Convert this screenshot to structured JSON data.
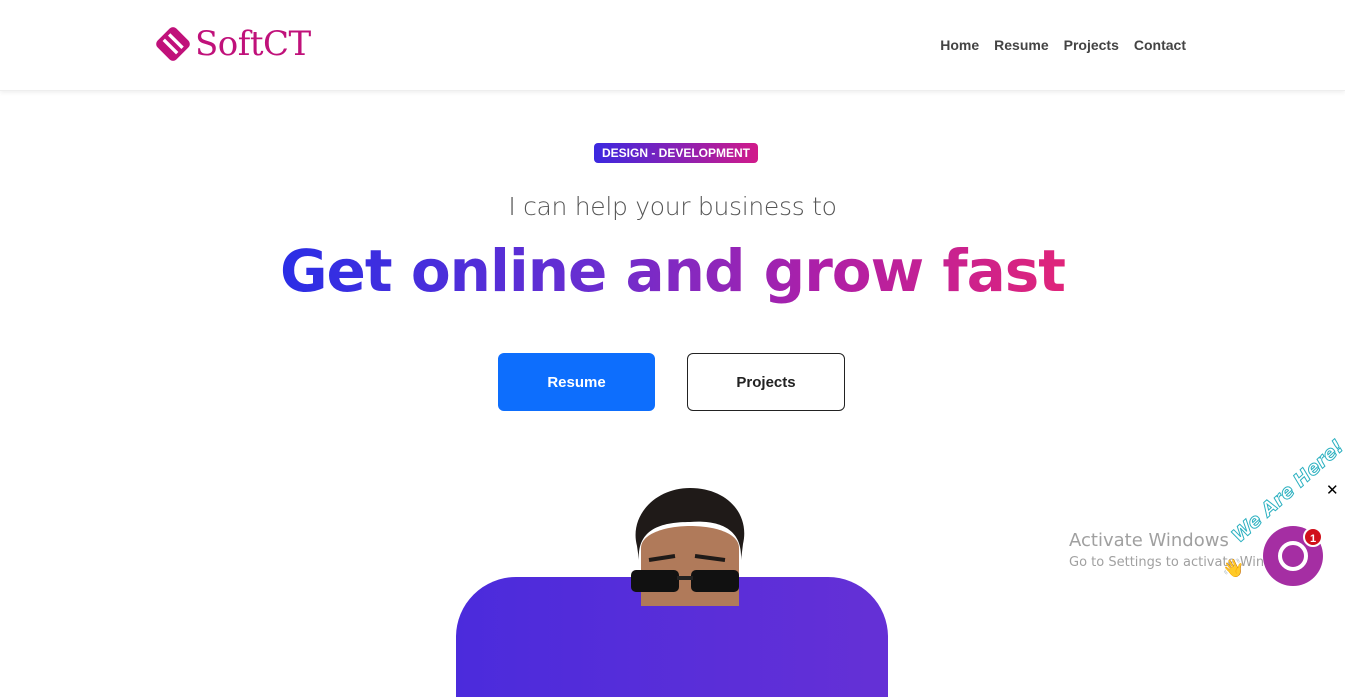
{
  "brand": {
    "name": "SoftCT",
    "color": "#c0117a"
  },
  "nav": {
    "links": [
      "Home",
      "Resume",
      "Projects",
      "Contact"
    ]
  },
  "hero": {
    "badge": "DESIGN - DEVELOPMENT",
    "subtitle": "I can help your business to",
    "headline": "Get online and grow fast",
    "primary_button": "Resume",
    "secondary_button": "Projects",
    "accent_start": "#2a2ee6",
    "accent_end": "#e0247a"
  },
  "watermark": {
    "title": "Activate Windows",
    "subtitle": "Go to Settings to activate Windows."
  },
  "chat_widget": {
    "banner": "We Are Here!",
    "unread_count": "1",
    "close_icon": "close-icon",
    "icon": "chat-bubble-icon"
  }
}
